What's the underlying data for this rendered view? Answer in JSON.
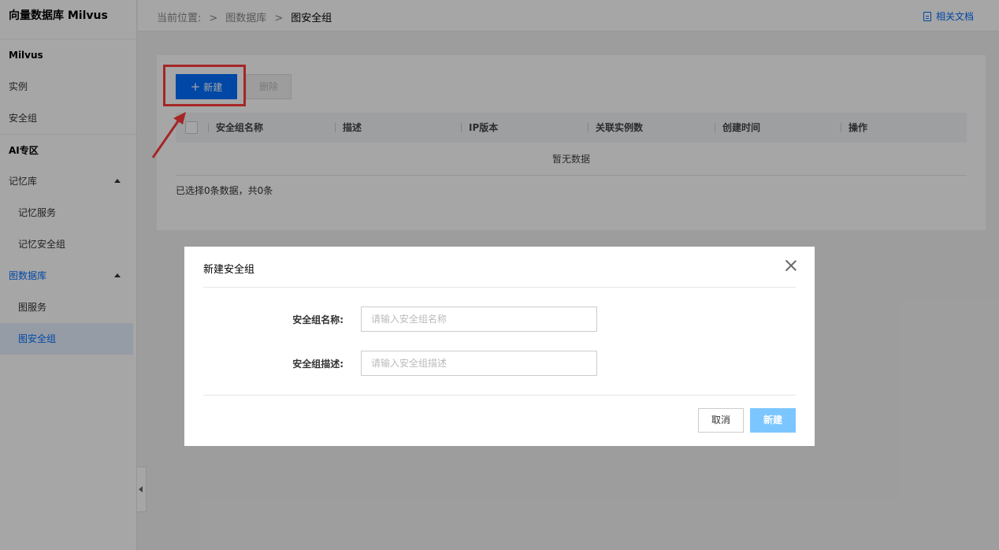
{
  "sidebar": {
    "title": "向量数据库 Milvus",
    "group_milvus": "Milvus",
    "item_instance": "实例",
    "item_security": "安全组",
    "group_ai": "AI专区",
    "memory": {
      "label": "记忆库",
      "service": "记忆服务",
      "security": "记忆安全组"
    },
    "graph": {
      "label": "图数据库",
      "service": "图服务",
      "security": "图安全组"
    }
  },
  "header": {
    "breadcrumb": [
      "当前位置:",
      "图数据库",
      "图安全组"
    ],
    "doc_link": "相关文档"
  },
  "toolbar": {
    "new_label": "新建",
    "delete_label": "删除"
  },
  "table": {
    "columns": [
      "安全组名称",
      "描述",
      "IP版本",
      "关联实例数",
      "创建时间",
      "操作"
    ],
    "empty_text": "暂无数据",
    "selection_info": "已选择0条数据，共0条"
  },
  "modal": {
    "title": "新建安全组",
    "name_label": "安全组名称:",
    "name_placeholder": "请输入安全组名称",
    "desc_label": "安全组描述:",
    "desc_placeholder": "请输入安全组描述",
    "cancel_label": "取消",
    "create_label": "新建"
  },
  "colors": {
    "primary": "#006eff",
    "highlight": "#ff3b3b",
    "create_disabled": "#7cc6ff"
  }
}
